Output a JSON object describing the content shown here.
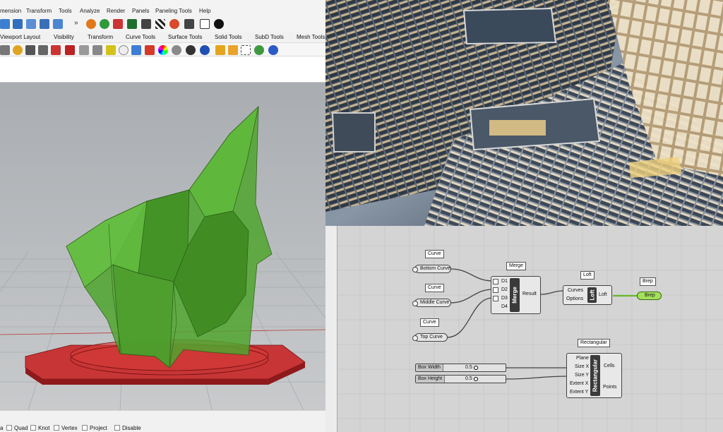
{
  "rhino": {
    "menu": [
      "mension",
      "Transform",
      "Tools",
      "Analyze",
      "Render",
      "Panels",
      "Paneling Tools",
      "Help"
    ],
    "overflow_chevron": "»",
    "tabs": [
      "Viewport Layout",
      "Visibility",
      "Transform",
      "Curve Tools",
      "Surface Tools",
      "Solid Tools",
      "SubD Tools",
      "Mesh Tools"
    ],
    "statusbar": {
      "first_fragment": "a",
      "snaps": [
        "Quad",
        "Knot",
        "Vertex",
        "Project",
        "Disable"
      ]
    },
    "colors": {
      "model_green": "#4fa52e",
      "ground_red": "#c8282a",
      "viewport_bg": "#b9bcbf"
    }
  },
  "grasshopper": {
    "labels": {
      "curve1": "Curve",
      "curve2": "Curve",
      "curve3": "Curve",
      "merge": "Merge",
      "loft": "Loft",
      "brep": "Brep",
      "rectangular": "Rectangular"
    },
    "params": {
      "bottom_curve": "Bottom Curve",
      "middle_curve": "Middle Curve",
      "top_curve": "Top Curve",
      "brep": "Brep"
    },
    "merge": {
      "name": "Merge",
      "inputs": [
        "D1",
        "D2",
        "D3",
        "D4"
      ],
      "output": "Result"
    },
    "loft": {
      "name": "Loft",
      "inputs": [
        "Curves",
        "Options"
      ],
      "output": "Loft"
    },
    "rectangular": {
      "name": "Rectangular",
      "inputs": [
        "Plane",
        "Size X",
        "Size Y",
        "Extent X",
        "Extent Y"
      ],
      "outputs": [
        "Cells",
        "Points"
      ]
    },
    "sliders": [
      {
        "name": "Box Width",
        "value": "0.5"
      },
      {
        "name": "Box Height",
        "value": "0.5"
      }
    ],
    "colors": {
      "canvas": "#d4d4d4",
      "component_core": "#3a3a3a",
      "active_param": "#a3e05b"
    }
  }
}
